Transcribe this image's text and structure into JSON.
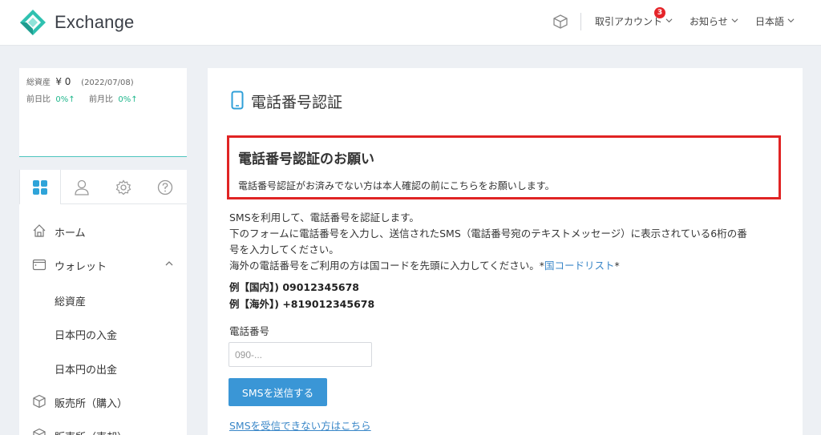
{
  "header": {
    "brand": "Exchange",
    "account_menu": "取引アカウント",
    "account_badge": "3",
    "news_menu": "お知らせ",
    "language_menu": "日本語"
  },
  "sidebar": {
    "summary": {
      "total_label": "総資産",
      "total_value": "¥ 0",
      "date": "(2022/07/08)",
      "day_label": "前日比",
      "day_value": "0%↑",
      "month_label": "前月比",
      "month_value": "0%↑"
    },
    "tabs": [
      "dashboard-icon",
      "user-icon",
      "gear-icon",
      "help-icon"
    ],
    "items": [
      {
        "label": "ホーム"
      },
      {
        "label": "ウォレット"
      },
      {
        "label": "総資産"
      },
      {
        "label": "日本円の入金"
      },
      {
        "label": "日本円の出金"
      },
      {
        "label": "販売所（購入）"
      },
      {
        "label": "販売所（売却）"
      }
    ]
  },
  "main": {
    "title": "電話番号認証",
    "notice": {
      "heading": "電話番号認証のお願い",
      "body": "電話番号認証がお済みでない方は本人確認の前にこちらをお願いします。"
    },
    "intro_1": "SMSを利用して、電話番号を認証します。",
    "intro_2": "下のフォームに電話番号を入力し、送信されたSMS（電話番号宛のテキストメッセージ）に表示されている6桁の番",
    "intro_3": "号を入力してください。",
    "intro_4_pre": "海外の電話番号をご利用の方は国コードを先頭に入力してください。*",
    "intro_4_link": "国コードリスト",
    "intro_4_post": "*",
    "example_domestic": "例【国内】) 09012345678",
    "example_overseas": "例【海外】) +819012345678",
    "phone_label": "電話番号",
    "phone_placeholder": "090-...",
    "phone_value": "",
    "send_button": "SMSを送信する",
    "help_link": "SMSを受信できない方はこちら"
  },
  "colors": {
    "accent": "#3a96d6",
    "brand_teal": "#2fc1b0",
    "notice_border": "#e02424",
    "badge": "#e5252a",
    "positive": "#1fb78c"
  }
}
